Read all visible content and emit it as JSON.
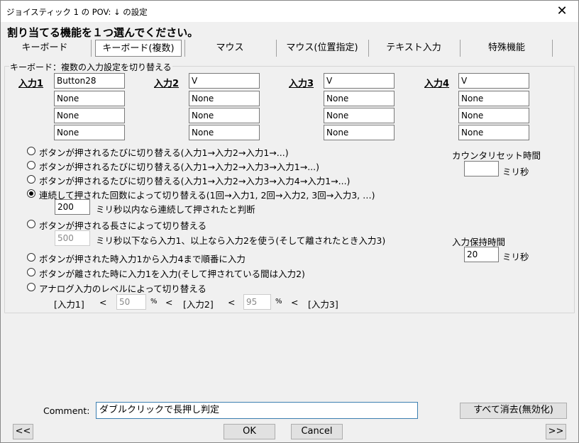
{
  "window": {
    "title": "ジョイスティック 1 の POV: ↓ の設定",
    "close_glyph": "✕"
  },
  "headline": "割り当てる機能を１つ選んでください。",
  "tabs": [
    {
      "label": "キーボード"
    },
    {
      "label": "キーボード(複数)"
    },
    {
      "label": "マウス"
    },
    {
      "label": "マウス(位置指定)"
    },
    {
      "label": "テキスト入力"
    },
    {
      "label": "特殊機能"
    }
  ],
  "group": {
    "title": "キーボード：複数の入力設定を切り替える",
    "inputs": [
      {
        "label": "入力1",
        "values": [
          "Button28",
          "None",
          "None",
          "None"
        ]
      },
      {
        "label": "入力2",
        "values": [
          "V",
          "None",
          "None",
          "None"
        ]
      },
      {
        "label": "入力3",
        "values": [
          "V",
          "None",
          "None",
          "None"
        ]
      },
      {
        "label": "入力4",
        "values": [
          "V",
          "None",
          "None",
          "None"
        ]
      }
    ],
    "options": [
      {
        "label": "ボタンが押されるたびに切り替える(入力1→入力2→入力1→...)",
        "checked": false
      },
      {
        "label": "ボタンが押されるたびに切り替える(入力1→入力2→入力3→入力1→...)",
        "checked": false
      },
      {
        "label": "ボタンが押されるたびに切り替える(入力1→入力2→入力3→入力4→入力1→...)",
        "checked": false
      },
      {
        "label": "連続して押された回数によって切り替える(1回→入力1, 2回→入力2, 3回→入力3, …)",
        "checked": true
      },
      {
        "label": "ボタンが押される長さによって切り替える",
        "checked": false
      },
      {
        "label": "ボタンが押された時入力1から入力4まで順番に入力",
        "checked": false
      },
      {
        "label": "ボタンが離された時に入力1を入力(そして押されている間は入力2)",
        "checked": false
      },
      {
        "label": "アナログ入力のレベルによって切り替える",
        "checked": false
      }
    ],
    "consecutive": {
      "value": "200",
      "suffix": "ミリ秒以内なら連続して押されたと判断"
    },
    "length": {
      "value": "500",
      "suffix": "ミリ秒以下なら入力1、以上なら入力2を使う(そして離されたとき入力3)"
    },
    "analog": {
      "label1": "[入力1]",
      "lt1": "<",
      "value1": "50",
      "pct1": "%",
      "lt2": "<",
      "label2": "[入力2]",
      "lt3": "<",
      "value2": "95",
      "pct2": "%",
      "lt4": "<",
      "label3": "[入力3]"
    },
    "counter_reset": {
      "title": "カウンタリセット時間",
      "value": "",
      "unit": "ミリ秒"
    },
    "hold_time": {
      "title": "入力保持時間",
      "value": "20",
      "unit": "ミリ秒"
    }
  },
  "comment": {
    "label": "Comment:",
    "value": "ダブルクリックで長押し判定"
  },
  "buttons": {
    "clear_all": "すべて消去(無効化)",
    "prev": "<<",
    "ok": "OK",
    "cancel": "Cancel",
    "next": ">>"
  }
}
